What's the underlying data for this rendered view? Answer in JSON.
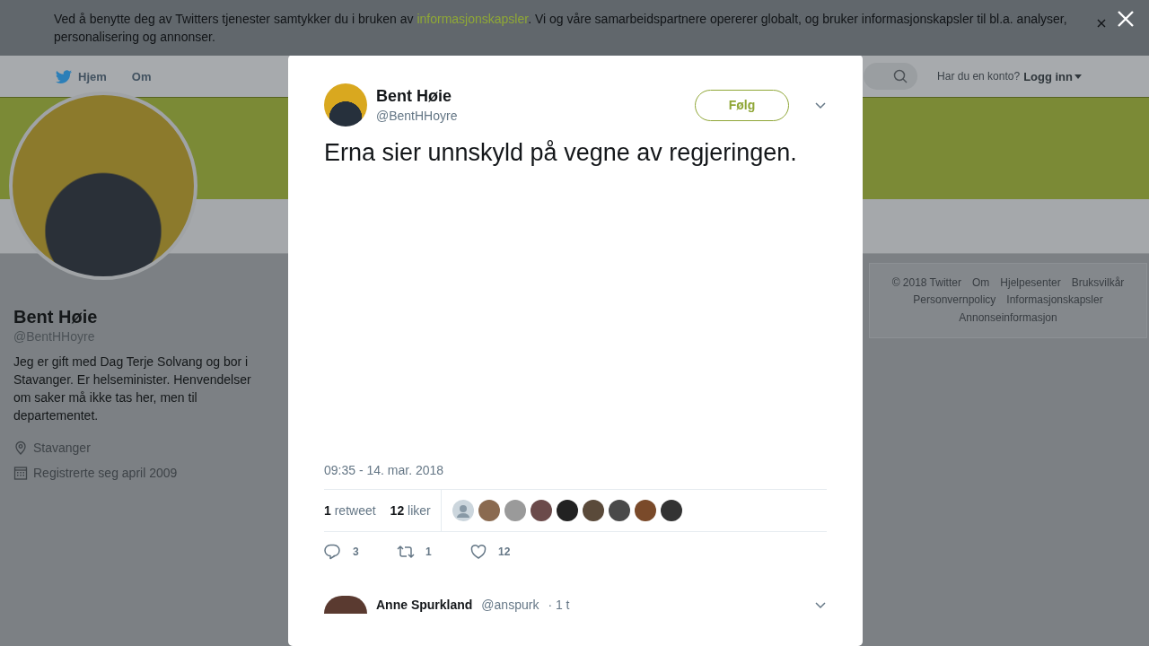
{
  "cookie_banner": {
    "text_before": "Ved å benytte deg av Twitters tjenester samtykker du i bruken av ",
    "link": "informasjonskapsler",
    "text_after": ". Vi og våre samarbeidspartnere opererer globalt, og bruker informasjonskapsler til bl.a. analyser, personalisering og annonser."
  },
  "top_nav": {
    "items": [
      {
        "label": "Hjem",
        "kind": "home"
      },
      {
        "label": "Om",
        "kind": "plain"
      }
    ],
    "account_prompt": "Har du en konto?",
    "login": "Logg inn"
  },
  "profile": {
    "name": "Bent Høie",
    "handle": "@BentHHoyre",
    "bio": "Jeg er gift med Dag Terje Solvang og bor i Stavanger. Er helseminister. Henvendelser om saker må ikke tas her, men til departementet.",
    "location": "Stavanger",
    "joined": "Registrerte seg april 2009"
  },
  "footer": {
    "links": [
      "© 2018 Twitter",
      "Om",
      "Hjelpesenter",
      "Bruksvilkår",
      "Personvernpolicy",
      "Informasjonskapsler",
      "Annonseinformasjon"
    ]
  },
  "tweet": {
    "author": "Bent Høie",
    "handle": "@BentHHoyre",
    "follow_label": "Følg",
    "text": "Erna sier unnskyld på vegne av regjeringen.",
    "timestamp": "09:35 - 14. mar. 2018",
    "stats": [
      {
        "count": "1",
        "label": "retweet"
      },
      {
        "count": "12",
        "label": "liker"
      }
    ],
    "liker_avatars": [
      {
        "kind": "silhouette"
      },
      {
        "kind": "photo"
      },
      {
        "kind": "photo"
      },
      {
        "kind": "photo"
      },
      {
        "kind": "photo"
      },
      {
        "kind": "photo"
      },
      {
        "kind": "photo"
      },
      {
        "kind": "photo"
      },
      {
        "kind": "photo"
      }
    ],
    "actions": [
      {
        "kind": "reply",
        "count": "3"
      },
      {
        "kind": "retweet",
        "count": "1"
      },
      {
        "kind": "like",
        "count": "12"
      }
    ],
    "reply": {
      "author": "Anne Spurkland",
      "handle": "@anspurk",
      "time": "· 1 t"
    }
  }
}
